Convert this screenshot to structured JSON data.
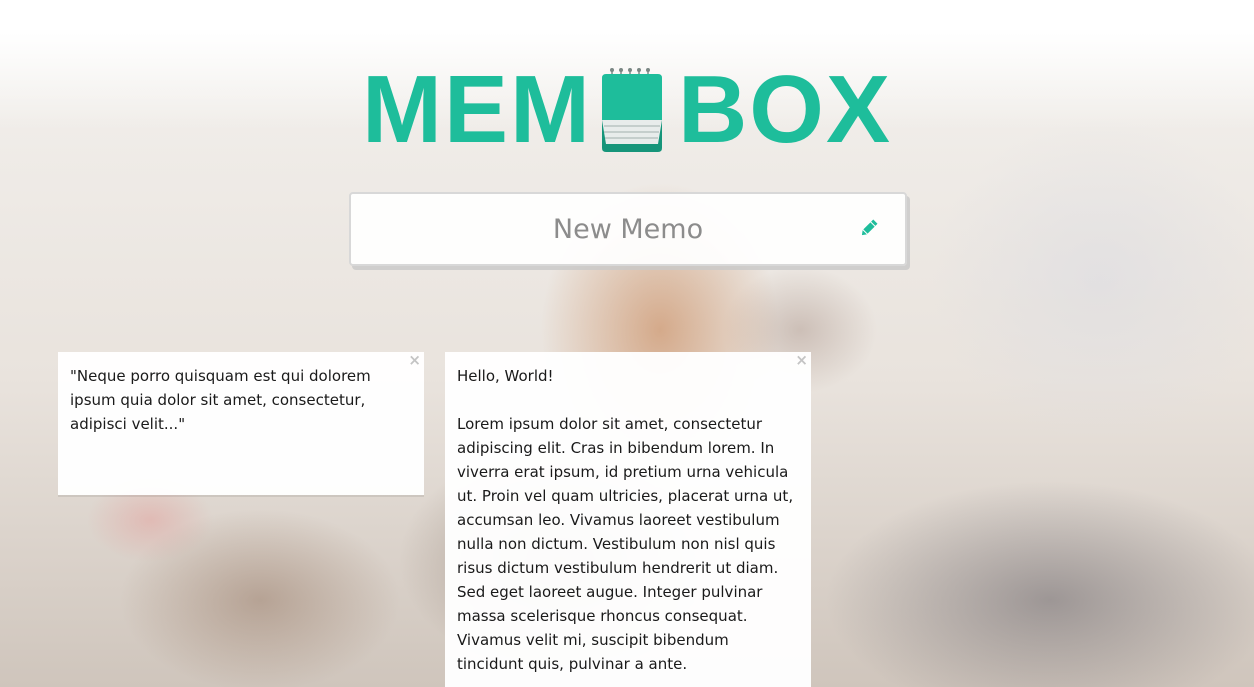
{
  "brand": {
    "left": "MEM",
    "right": "BOX",
    "icon": "notepad-icon",
    "color": "#1ebd9b"
  },
  "new_memo": {
    "placeholder": "New Memo",
    "icon": "pencil-icon"
  },
  "memos": [
    {
      "close": "×",
      "paragraphs": [
        "\"Neque porro quisquam est qui dolorem ipsum quia dolor sit amet, consectetur, adipisci velit...\""
      ]
    },
    {
      "close": "×",
      "paragraphs": [
        "Hello, World!",
        "Lorem ipsum dolor sit amet, consectetur adipiscing elit. Cras in bibendum lorem. In viverra erat ipsum, id pretium urna vehicula ut. Proin vel quam ultricies, placerat urna ut, accumsan leo. Vivamus laoreet vestibulum nulla non dictum. Vestibulum non nisl quis risus dictum vestibulum hendrerit ut diam. Sed eget laoreet augue. Integer pulvinar massa scelerisque rhoncus consequat. Vivamus velit mi, suscipit bibendum tincidunt quis, pulvinar a ante."
      ]
    }
  ]
}
